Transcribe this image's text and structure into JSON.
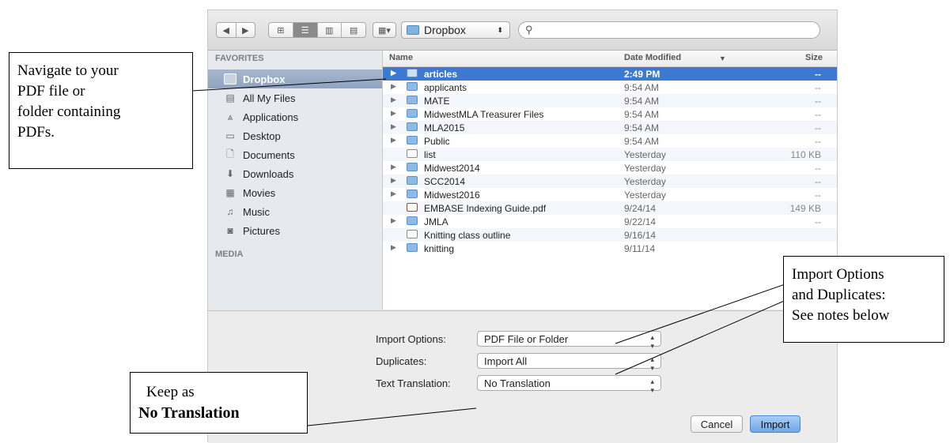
{
  "toolbar": {
    "back_icon": "back-arrow-icon",
    "forward_icon": "forward-arrow-icon",
    "path_label": "Dropbox",
    "search_placeholder": ""
  },
  "sidebar": {
    "favorites_header": "FAVORITES",
    "media_header": "MEDIA",
    "items": [
      {
        "label": "Dropbox",
        "icon": "dropbox-folder-icon"
      },
      {
        "label": "All My Files",
        "icon": "all-files-icon"
      },
      {
        "label": "Applications",
        "icon": "applications-icon"
      },
      {
        "label": "Desktop",
        "icon": "desktop-icon"
      },
      {
        "label": "Documents",
        "icon": "documents-icon"
      },
      {
        "label": "Downloads",
        "icon": "downloads-icon"
      },
      {
        "label": "Movies",
        "icon": "movies-icon"
      },
      {
        "label": "Music",
        "icon": "music-icon"
      },
      {
        "label": "Pictures",
        "icon": "pictures-icon"
      }
    ]
  },
  "filelist": {
    "columns": {
      "name": "Name",
      "date": "Date Modified",
      "size": "Size"
    },
    "rows": [
      {
        "name": "articles",
        "date": "2:49 PM",
        "size": "--"
      },
      {
        "name": "applicants",
        "date": "9:54 AM",
        "size": "--"
      },
      {
        "name": "MATE",
        "date": "9:54 AM",
        "size": "--"
      },
      {
        "name": "MidwestMLA Treasurer Files",
        "date": "9:54 AM",
        "size": "--"
      },
      {
        "name": "MLA2015",
        "date": "9:54 AM",
        "size": "--"
      },
      {
        "name": "Public",
        "date": "9:54 AM",
        "size": "--"
      },
      {
        "name": "list",
        "date": "Yesterday",
        "size": "110 KB"
      },
      {
        "name": "Midwest2014",
        "date": "Yesterday",
        "size": "--"
      },
      {
        "name": "SCC2014",
        "date": "Yesterday",
        "size": "--"
      },
      {
        "name": "Midwest2016",
        "date": "Yesterday",
        "size": "--"
      },
      {
        "name": "EMBASE Indexing Guide.pdf",
        "date": "9/24/14",
        "size": "149 KB"
      },
      {
        "name": "JMLA",
        "date": "9/22/14",
        "size": "--"
      },
      {
        "name": "Knitting class outline",
        "date": "9/16/14",
        "size": ""
      },
      {
        "name": "knitting",
        "date": "9/11/14",
        "size": ""
      }
    ]
  },
  "options": {
    "import_label": "Import Options:",
    "import_value": "PDF File or Folder",
    "duplicates_label": "Duplicates:",
    "duplicates_value": "Import All",
    "translation_label": "Text Translation:",
    "translation_value": "No Translation"
  },
  "buttons": {
    "cancel": "Cancel",
    "import": "Import"
  },
  "callouts": {
    "navigate_1": "Navigate to your",
    "navigate_2": "PDF file or",
    "navigate_3": "folder containing",
    "navigate_4": "PDFs.",
    "import_opts_1": "Import Options",
    "import_opts_2": "and Duplicates:",
    "import_opts_3": "See notes below",
    "keep_1": "Keep as",
    "keep_2": "No Translation"
  },
  "colors": {
    "selection": "#3b79d3",
    "accent_button": "#6fa8ea"
  }
}
